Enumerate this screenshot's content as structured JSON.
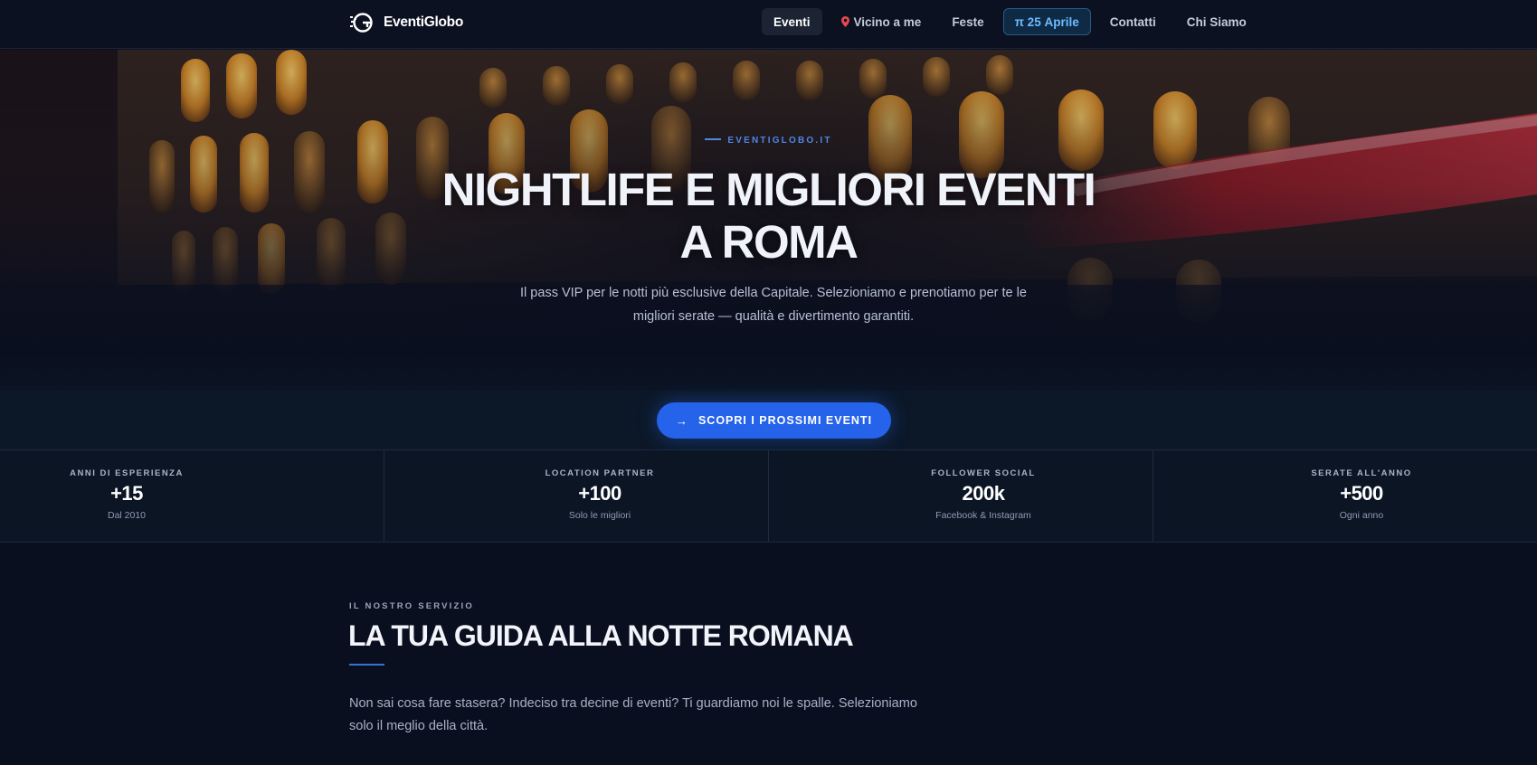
{
  "brand": {
    "name": "EventiGlobo",
    "logo_icon": "globe-g-logo-icon"
  },
  "nav": {
    "items": [
      {
        "label": "Eventi",
        "state": "active"
      },
      {
        "label": "Vicino a me",
        "icon": "map-pin-icon"
      },
      {
        "label": "Feste"
      },
      {
        "label": "π 25 Aprile",
        "state": "highlighted"
      },
      {
        "label": "Contatti"
      },
      {
        "label": "Chi Siamo"
      }
    ]
  },
  "hero": {
    "eyebrow": "EVENTIGLOBO.IT",
    "title_line1": "NIGHTLIFE E MIGLIORI EVENTI",
    "title_line2": "A ROMA",
    "subtitle": "Il pass VIP per le notti più esclusive della Capitale. Selezioniamo e prenotiamo per te le migliori serate — qualità e divertimento garantiti."
  },
  "cta": {
    "label": "SCOPRI I PROSSIMI EVENTI",
    "icon": "arrow-right-icon"
  },
  "stats": [
    {
      "label": "ANNI DI ESPERIENZA",
      "value": "+15",
      "note": "Dal 2010"
    },
    {
      "label": "LOCATION PARTNER",
      "value": "+100",
      "note": "Solo le migliori"
    },
    {
      "label": "FOLLOWER SOCIAL",
      "value": "200k",
      "note": "Facebook & Instagram"
    },
    {
      "label": "SERATE ALL'ANNO",
      "value": "+500",
      "note": "Ogni anno"
    }
  ],
  "service": {
    "eyebrow": "IL NOSTRO SERVIZIO",
    "title": "LA TUA GUIDA ALLA NOTTE ROMANA",
    "text": "Non sai cosa fare stasera? Indeciso tra decine di eventi? Ti guardiamo noi le spalle. Selezioniamo solo il meglio della città."
  },
  "colors": {
    "background": "#0a0f1f",
    "navbar": "#0b1120",
    "accent": "#2563eb",
    "eyebrow_accent": "#4f86e6",
    "highlight_nav_text": "#6dbcff"
  }
}
